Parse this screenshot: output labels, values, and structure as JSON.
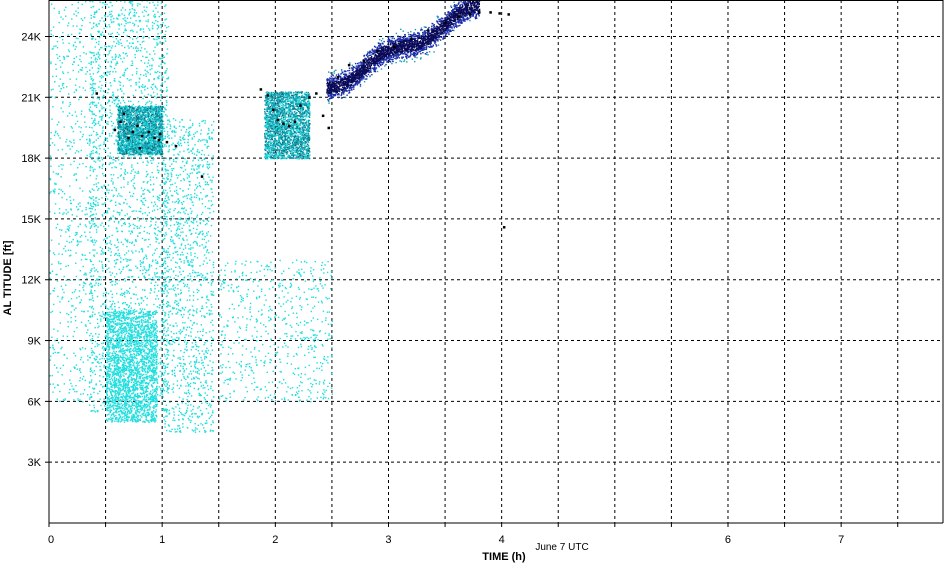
{
  "chart_data": {
    "type": "scatter",
    "title": "",
    "xlabel": "TIME (h)",
    "ylabel": "AL TITUDE [ft]",
    "caption": "June 7 UTC",
    "xlim": [
      0,
      7.9
    ],
    "ylim": [
      0,
      25800
    ],
    "x_ticks": [
      0,
      1,
      2,
      3,
      4,
      5,
      6,
      7
    ],
    "x_tick_labels": [
      "0",
      "1",
      "2",
      "3",
      "4",
      "",
      "6",
      "7"
    ],
    "x_minor_gridlines": [
      0.5,
      1.5,
      2.5,
      3.5,
      4.5,
      5.5,
      6.5,
      7.5
    ],
    "y_ticks": [
      3000,
      6000,
      9000,
      12000,
      15000,
      18000,
      21000,
      24000
    ],
    "y_tick_labels": [
      "3K",
      "6K",
      "9K",
      "12K",
      "15K",
      "18K",
      "21K",
      "24K"
    ],
    "grid": true,
    "grid_style": "dashed",
    "colors": {
      "cyan": "#22dede",
      "teal": "#12a0b4",
      "blue": "#1c2fa8",
      "navy": "#0a0a5a",
      "black": "#000000",
      "grid": "#000000"
    },
    "clusters": [
      {
        "x": [
          0.0,
          0.4
        ],
        "y": [
          6000,
          25800
        ],
        "density": "sparse",
        "color": "cyan"
      },
      {
        "x": [
          0.35,
          1.05
        ],
        "y": [
          5500,
          25800
        ],
        "density": "dense",
        "color": "cyan"
      },
      {
        "x": [
          0.5,
          0.95
        ],
        "y": [
          5000,
          10500
        ],
        "density": "dense",
        "color": "cyan"
      },
      {
        "x": [
          1.0,
          1.45
        ],
        "y": [
          4500,
          20000
        ],
        "density": "medium",
        "color": "cyan"
      },
      {
        "x": [
          1.5,
          2.5
        ],
        "y": [
          6000,
          13000
        ],
        "density": "sparse",
        "color": "cyan"
      },
      {
        "x": [
          0.6,
          1.0
        ],
        "y": [
          18200,
          20600
        ],
        "density": "dense",
        "color": "teal"
      },
      {
        "x": [
          1.9,
          2.3
        ],
        "y": [
          18000,
          21300
        ],
        "density": "dense",
        "color": "teal"
      },
      {
        "x": [
          2.45,
          3.8
        ],
        "y": [
          20500,
          25800
        ],
        "density": "band",
        "color": "blue"
      }
    ],
    "black_points": [
      [
        0.58,
        19400
      ],
      [
        0.63,
        19800
      ],
      [
        0.66,
        20200
      ],
      [
        0.7,
        19000
      ],
      [
        0.74,
        19300
      ],
      [
        0.78,
        19600
      ],
      [
        0.82,
        19100
      ],
      [
        0.88,
        19300
      ],
      [
        0.93,
        19000
      ],
      [
        0.97,
        18900
      ],
      [
        1.04,
        18800
      ],
      [
        1.12,
        18600
      ],
      [
        0.98,
        19200
      ],
      [
        0.8,
        18500
      ],
      [
        1.87,
        21400
      ],
      [
        1.93,
        21100
      ],
      [
        1.98,
        20400
      ],
      [
        2.02,
        19900
      ],
      [
        2.07,
        19700
      ],
      [
        2.12,
        19600
      ],
      [
        2.17,
        19800
      ],
      [
        2.22,
        20600
      ],
      [
        2.3,
        21000
      ],
      [
        2.36,
        21200
      ],
      [
        2.42,
        20100
      ],
      [
        2.47,
        19500
      ],
      [
        2.55,
        22000
      ],
      [
        2.65,
        22600
      ],
      [
        2.78,
        22800
      ],
      [
        2.9,
        23300
      ],
      [
        3.05,
        23500
      ],
      [
        3.2,
        23900
      ],
      [
        3.35,
        24300
      ],
      [
        3.5,
        24700
      ],
      [
        3.62,
        25000
      ],
      [
        3.72,
        25100
      ],
      [
        3.8,
        25200
      ],
      [
        3.9,
        25200
      ],
      [
        3.98,
        25150
      ],
      [
        4.06,
        25100
      ],
      [
        4.02,
        14600
      ],
      [
        1.35,
        17100
      ],
      [
        0.42,
        21200
      ]
    ]
  }
}
